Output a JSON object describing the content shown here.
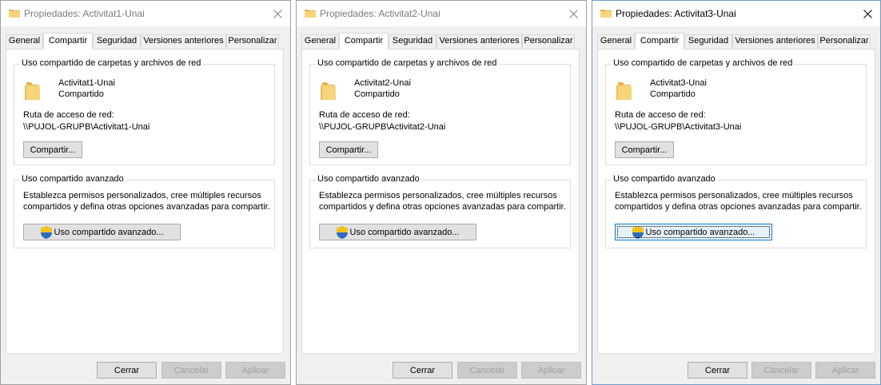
{
  "tabs": [
    "General",
    "Compartir",
    "Seguridad",
    "Versiones anteriores",
    "Personalizar"
  ],
  "labels": {
    "network_group": "Uso compartido de carpetas y archivos de red",
    "shared_status": "Compartido",
    "network_path_label": "Ruta de acceso de red:",
    "share_button": "Compartir...",
    "advanced_group": "Uso compartido avanzado",
    "advanced_desc_1": "Establezca permisos personalizados, cree múltiples recursos",
    "advanced_desc_2": "compartidos y defina otras opciones avanzadas para compartir.",
    "advanced_button": "Uso compartido avanzado...",
    "ok_button": "Cerrar",
    "cancel_button": "Cancelar",
    "apply_button": "Aplicar"
  },
  "windows": [
    {
      "title": "Propiedades: Activitat1-Unai",
      "folder_name": "Activitat1-Unai",
      "network_path": "\\\\PUJOL-GRUPB\\Activitat1-Unai"
    },
    {
      "title": "Propiedades: Activitat2-Unai",
      "folder_name": "Activitat2-Unai",
      "network_path": "\\\\PUJOL-GRUPB\\Activitat2-Unai"
    },
    {
      "title": "Propiedades: Activitat3-Unai",
      "folder_name": "Activitat3-Unai",
      "network_path": "\\\\PUJOL-GRUPB\\Activitat3-Unai"
    }
  ],
  "colors": {
    "focus_border": "#0078d7",
    "folder_yellow": "#f7d47a",
    "shield_blue": "#2f6cc0",
    "shield_yellow": "#f2c318"
  },
  "icons": {
    "folder": "folder-icon",
    "shield": "uac-shield-icon",
    "close": "close-icon"
  }
}
